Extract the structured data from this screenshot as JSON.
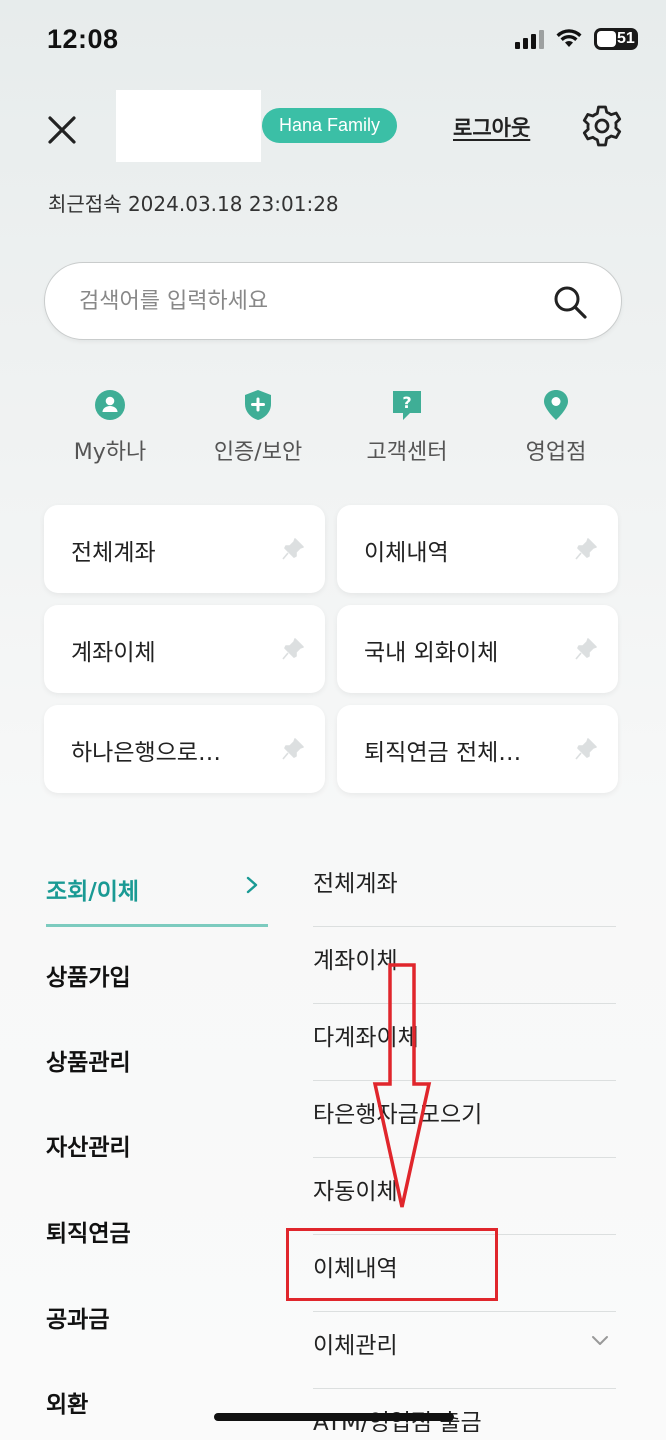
{
  "status": {
    "time": "12:08",
    "battery": "51"
  },
  "header": {
    "badge": "Hana Family",
    "logout": "로그아웃"
  },
  "last_access": "최근접속 2024.03.18 23:01:28",
  "search": {
    "placeholder": "검색어를 입력하세요"
  },
  "quick_menu": [
    {
      "label": "My하나",
      "icon": "person-icon"
    },
    {
      "label": "인증/보안",
      "icon": "shield-icon"
    },
    {
      "label": "고객센터",
      "icon": "help-chat-icon"
    },
    {
      "label": "영업점",
      "icon": "location-pin-icon"
    }
  ],
  "favorites": [
    {
      "label": "전체계좌"
    },
    {
      "label": "이체내역"
    },
    {
      "label": "계좌이체"
    },
    {
      "label": "국내 외화이체"
    },
    {
      "label": "하나은행으로…"
    },
    {
      "label": "퇴직연금 전체…"
    }
  ],
  "categories": [
    {
      "label": "조회/이체",
      "active": true
    },
    {
      "label": "상품가입"
    },
    {
      "label": "상품관리"
    },
    {
      "label": "자산관리"
    },
    {
      "label": "퇴직연금"
    },
    {
      "label": "공과금"
    },
    {
      "label": "외환"
    }
  ],
  "submenu": [
    {
      "label": "전체계좌"
    },
    {
      "label": "계좌이체"
    },
    {
      "label": "다계좌이체"
    },
    {
      "label": "타은행자금모으기"
    },
    {
      "label": "자동이체"
    },
    {
      "label": "이체내역"
    },
    {
      "label": "이체관리",
      "expandable": true
    },
    {
      "label": "ATM/영업점 출금"
    }
  ],
  "colors": {
    "accent": "#1a9a94",
    "badge": "#3bbfa6",
    "annotation": "#e0262c"
  }
}
